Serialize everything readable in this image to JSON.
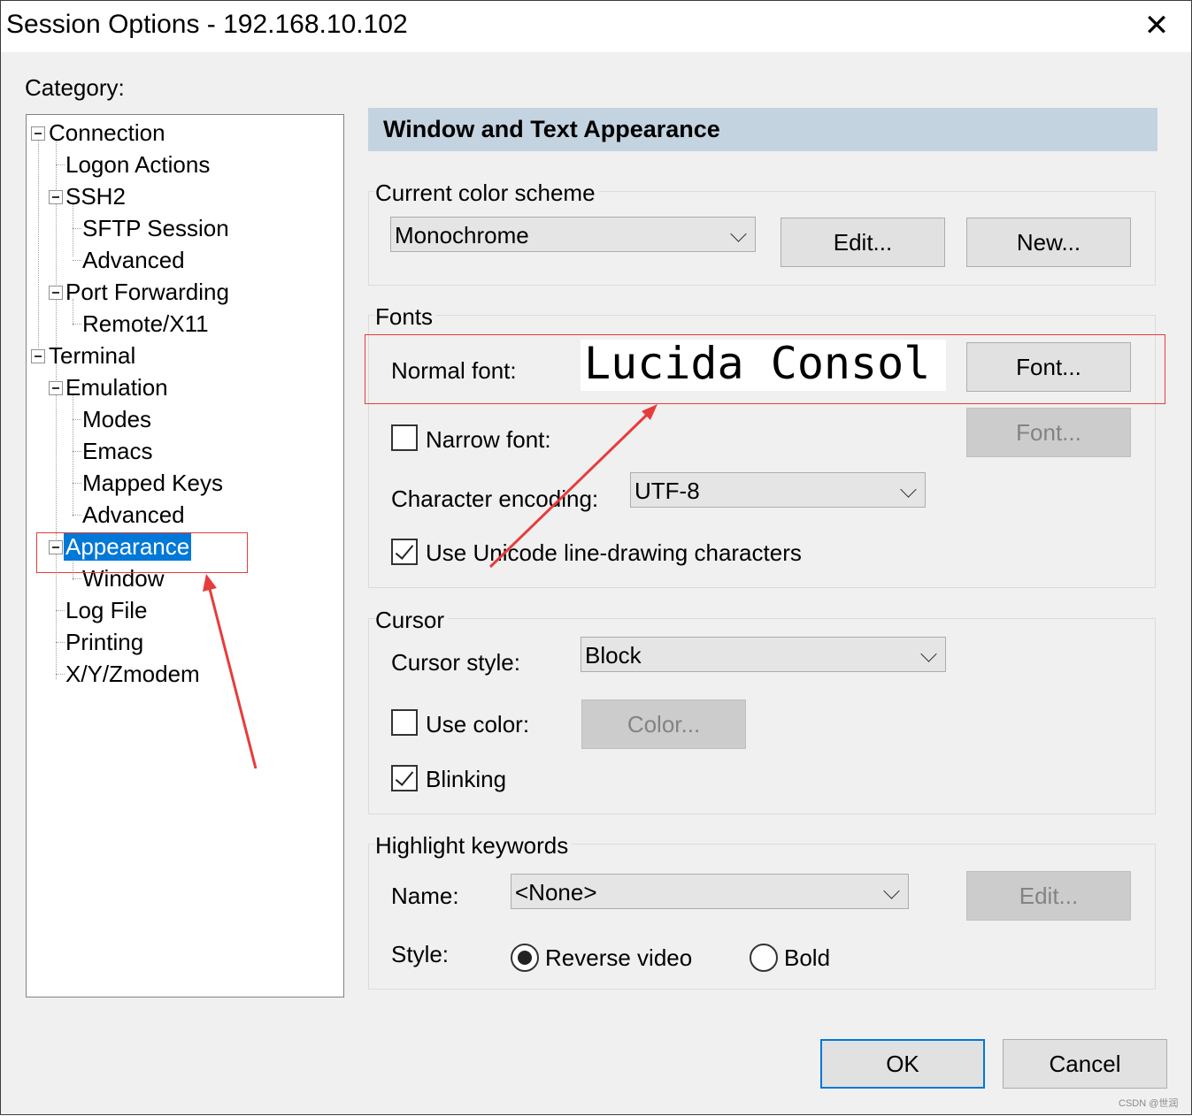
{
  "window": {
    "title": "Session Options - 192.168.10.102",
    "close_glyph": "✕"
  },
  "category_label": "Category:",
  "tree": {
    "connection": "Connection",
    "logon_actions": "Logon Actions",
    "ssh2": "SSH2",
    "sftp_session": "SFTP Session",
    "ssh2_advanced": "Advanced",
    "port_forwarding": "Port Forwarding",
    "remote_x11": "Remote/X11",
    "terminal": "Terminal",
    "emulation": "Emulation",
    "modes": "Modes",
    "emacs": "Emacs",
    "mapped_keys": "Mapped Keys",
    "emulation_advanced": "Advanced",
    "appearance": "Appearance",
    "window": "Window",
    "log_file": "Log File",
    "printing": "Printing",
    "xyzmodem": "X/Y/Zmodem",
    "selected": "Appearance"
  },
  "panel": {
    "header": "Window and Text Appearance",
    "color_scheme": {
      "title": "Current color scheme",
      "value": "Monochrome",
      "edit_label": "Edit...",
      "new_label": "New..."
    },
    "fonts": {
      "title": "Fonts",
      "normal_font_label": "Normal font:",
      "normal_font_preview": "Lucida Consol",
      "font_button": "Font...",
      "narrow_font_label": "Narrow font:",
      "narrow_font_checked": false,
      "narrow_font_button": "Font...",
      "encoding_label": "Character encoding:",
      "encoding_value": "UTF-8",
      "unicode_label": "Use Unicode line-drawing characters",
      "unicode_checked": true
    },
    "cursor": {
      "title": "Cursor",
      "style_label": "Cursor style:",
      "style_value": "Block",
      "use_color_label": "Use color:",
      "use_color_checked": false,
      "color_button": "Color...",
      "blinking_label": "Blinking",
      "blinking_checked": true
    },
    "highlight": {
      "title": "Highlight keywords",
      "name_label": "Name:",
      "name_value": "<None>",
      "edit_label": "Edit...",
      "style_label": "Style:",
      "reverse_video_label": "Reverse video",
      "bold_label": "Bold",
      "selected_style": "Reverse video"
    }
  },
  "footer": {
    "ok_label": "OK",
    "cancel_label": "Cancel"
  },
  "annotations": {
    "color": "#e63c3c"
  },
  "watermark": "CSDN @世润"
}
